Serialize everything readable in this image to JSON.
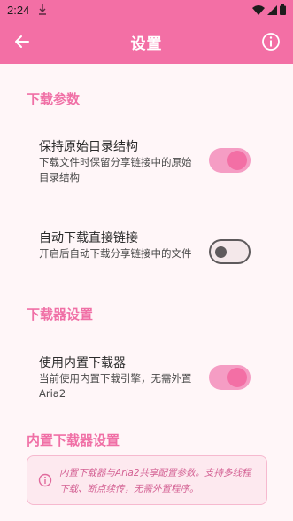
{
  "status_bar": {
    "time": "2:24"
  },
  "app_bar": {
    "title": "设置"
  },
  "sections": {
    "download_params": {
      "title": "下载参数",
      "keep_structure": {
        "title": "保持原始目录结构",
        "desc": "下载文件时保留分享链接中的原始目录结构",
        "enabled": true
      },
      "auto_direct": {
        "title": "自动下载直接链接",
        "desc": "开启后自动下载分享链接中的文件",
        "enabled": false
      }
    },
    "downloader_settings": {
      "title": "下载器设置",
      "builtin": {
        "title": "使用内置下载器",
        "desc": "当前使用内置下载引擎，无需外置Aria2",
        "enabled": true
      }
    },
    "builtin_downloader_settings": {
      "title": "内置下载器设置",
      "info": "内置下载器与Aria2共享配置参数。支持多线程下载、断点续传，无需外置程序。"
    }
  },
  "colors": {
    "accent": "#f36fa5",
    "toggle_on_track": "#f59dc4",
    "background": "#fff6f8"
  }
}
